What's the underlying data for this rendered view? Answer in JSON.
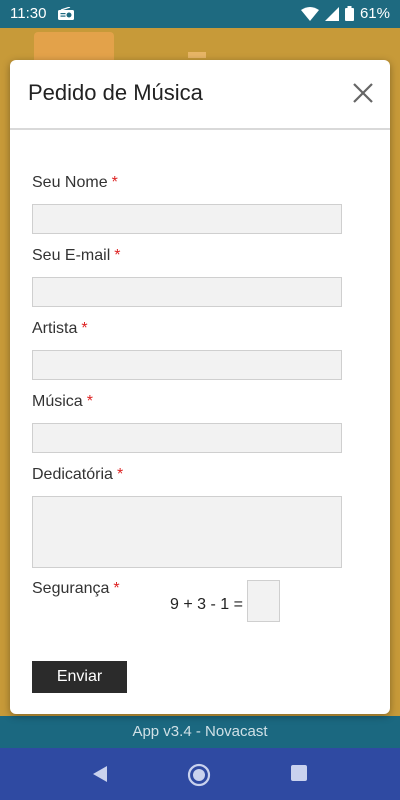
{
  "status_bar": {
    "time": "11:30",
    "battery": "61%"
  },
  "modal": {
    "title": "Pedido de Música",
    "fields": {
      "name_label": "Seu Nome",
      "email_label": "Seu E-mail",
      "artist_label": "Artista",
      "song_label": "Música",
      "dedication_label": "Dedicatória",
      "security_label": "Segurança",
      "required_mark": "*"
    },
    "captcha": {
      "equation": "9 + 3 - 1 ="
    },
    "submit_label": "Enviar"
  },
  "footer": {
    "text": "App v3.4 - Novacast"
  },
  "colors": {
    "status_bar": "#1e6a80",
    "app_background": "#c79a39",
    "navbar": "#2f4aa2",
    "required": "#dd2222",
    "button": "#2b2b2b"
  }
}
